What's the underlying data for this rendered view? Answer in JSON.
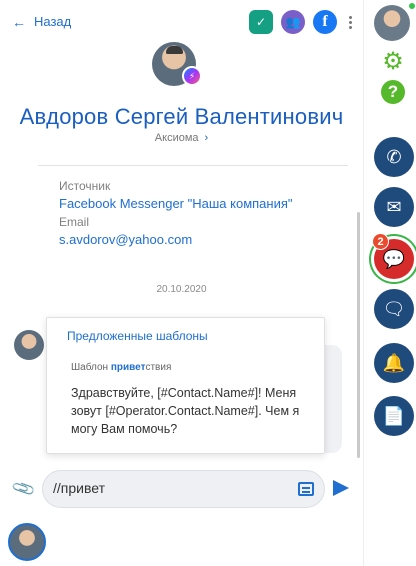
{
  "header": {
    "back_label": "Назад"
  },
  "contact": {
    "name": "Авдоров Сергей Валентинович",
    "organization": "Аксиома"
  },
  "info": {
    "source_label": "Источник",
    "source_value": "Facebook Messenger \"Наша компания\"",
    "email_label": "Email",
    "email_value": "s.avdorov@yahoo.com"
  },
  "chat": {
    "date": "20.10.2020"
  },
  "templates_popup": {
    "title": "Предложенные шаблоны",
    "template_prefix": "Шаблон ",
    "template_highlight": "привет",
    "template_suffix": "ствия",
    "template_text": "Здравствуйте, [#Contact.Name#]! Меня зовут [#Operator.Contact.Name#]. Чем я могу Вам помочь?"
  },
  "composer": {
    "value": "//привет"
  },
  "rail": {
    "unread_count": "2",
    "buttons": [
      "phone-icon",
      "email-icon",
      "chat-icon",
      "messages-icon",
      "bell-icon",
      "document-icon"
    ]
  },
  "colors": {
    "accent": "#1e6fd0",
    "rail_button": "#1f4a7c",
    "active_chat": "#d62b2b",
    "green": "#56b82b"
  }
}
